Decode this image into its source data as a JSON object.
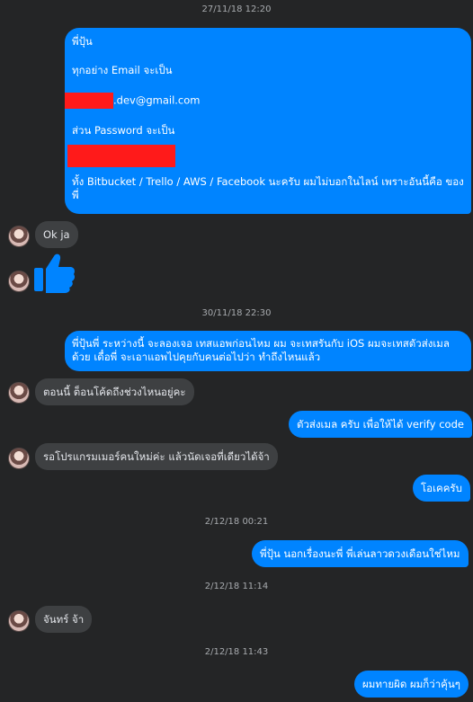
{
  "colors": {
    "outgoing": "#0084ff",
    "incoming": "#3e4042",
    "background": "#242526",
    "redaction": "#ff1a1a"
  },
  "timestamps": [
    "27/11/18 12:20",
    "30/11/18 22:30",
    "2/12/18 00:21",
    "2/12/18 11:14",
    "2/12/18 11:43"
  ],
  "msg1": {
    "line1": "พี่ปุ้น",
    "line2": "ทุกอย่าง Email จะเป็น",
    "email_suffix": ".dev@gmail.com",
    "line4": "ส่วน Password จะเป็น",
    "line6": "ทั้ง Bitbucket / Trello / AWS / Facebook นะครับ ผมไม่บอกในไลน์ เพราะอันนี้คือ ของพี่"
  },
  "in1": "Ok ja",
  "like_icon": "thumbs-up-icon",
  "out2": "พี่ปุ้นพี่ ระหว่างนี้ จะลองเจอ เทสแอพก่อนไหม ผม จะเทสรันกับ iOS ผมจะเทสตัวส่งเมล ด้วย เดื๋อพี่ จะเอาแอพไปคุยกับคนต่อไปว่า ทำถึงไหนแล้ว",
  "in2": "ตอนนี้ ต็อนโค้ดถึงช่วงไหนอยู่คะ",
  "out3": "ตัวส่งเมล ครับ เพื่อให้ได้ verify code",
  "in3": "รอโปรแกรมเมอร์คนใหม่ค่ะ แล้วนัดเจอที่เดียวได้จ้า",
  "out4": "โอเคครับ",
  "out5": "พี่ปุ้น นอกเรื่องนะพี่ พี่เล่นลาวดวงเดือนใช่ไหม",
  "in4": "จันทร์ จ้า",
  "out6": "ผมทายผิด ผมก็ว่าคุ้นๆ"
}
